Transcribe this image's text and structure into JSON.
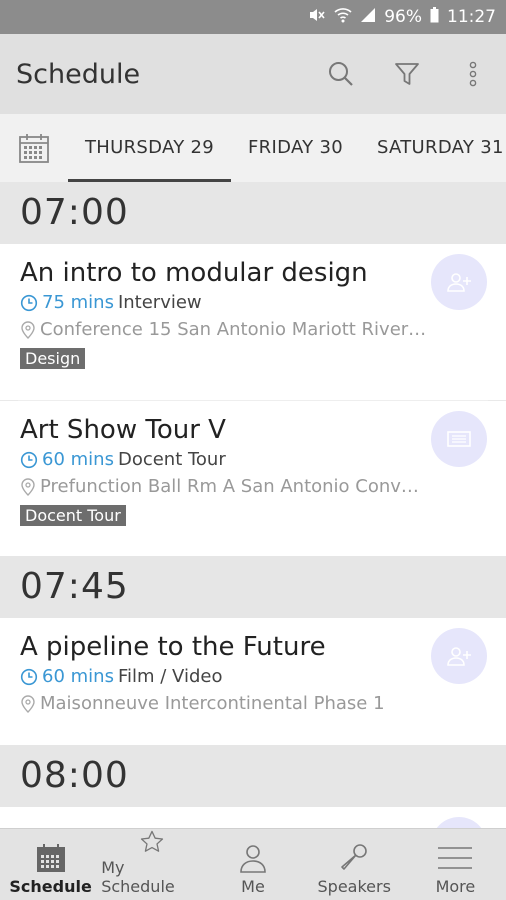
{
  "status_bar": {
    "battery": "96%",
    "time": "11:27",
    "icons": [
      "mute-icon",
      "wifi-icon",
      "signal-icon",
      "battery-icon"
    ]
  },
  "app_bar": {
    "title": "Schedule",
    "actions": [
      "search-icon",
      "filter-icon",
      "more-vert-icon"
    ]
  },
  "day_tabs": [
    {
      "label": "THURSDAY 29",
      "active": true
    },
    {
      "label": "FRIDAY 30",
      "active": false
    },
    {
      "label": "SATURDAY 31",
      "active": false
    }
  ],
  "schedule": [
    {
      "time": "07:00",
      "sessions": [
        {
          "title": "An intro to modular design",
          "duration": "75 mins",
          "type": "Interview",
          "location": "Conference 15 San Antonio Mariott River…",
          "tag": "Design",
          "action_icon": "add-person-icon"
        },
        {
          "title": "Art Show Tour V",
          "duration": "60 mins",
          "type": "Docent Tour",
          "location": "Prefunction Ball Rm A San Antonio Conv…",
          "tag": "Docent Tour",
          "action_icon": "ticket-icon"
        }
      ]
    },
    {
      "time": "07:45",
      "sessions": [
        {
          "title": "A pipeline to the Future",
          "duration": "60 mins",
          "type": "Film / Video",
          "location": "Maisonneuve Intercontinental Phase 1",
          "tag": "",
          "action_icon": "add-person-icon"
        }
      ]
    },
    {
      "time": "08:00",
      "sessions": []
    }
  ],
  "bottom_nav": [
    {
      "label": "Schedule",
      "icon": "calendar-icon",
      "active": true
    },
    {
      "label": "My Schedule",
      "icon": "star-icon",
      "active": false
    },
    {
      "label": "Me",
      "icon": "person-icon",
      "active": false
    },
    {
      "label": "Speakers",
      "icon": "microphone-icon",
      "active": false
    },
    {
      "label": "More",
      "icon": "menu-icon",
      "active": false
    }
  ],
  "colors": {
    "accent": "#3a97d4",
    "tag_bg": "#6d6d6d",
    "fab_bg": "#e6e6fb"
  }
}
